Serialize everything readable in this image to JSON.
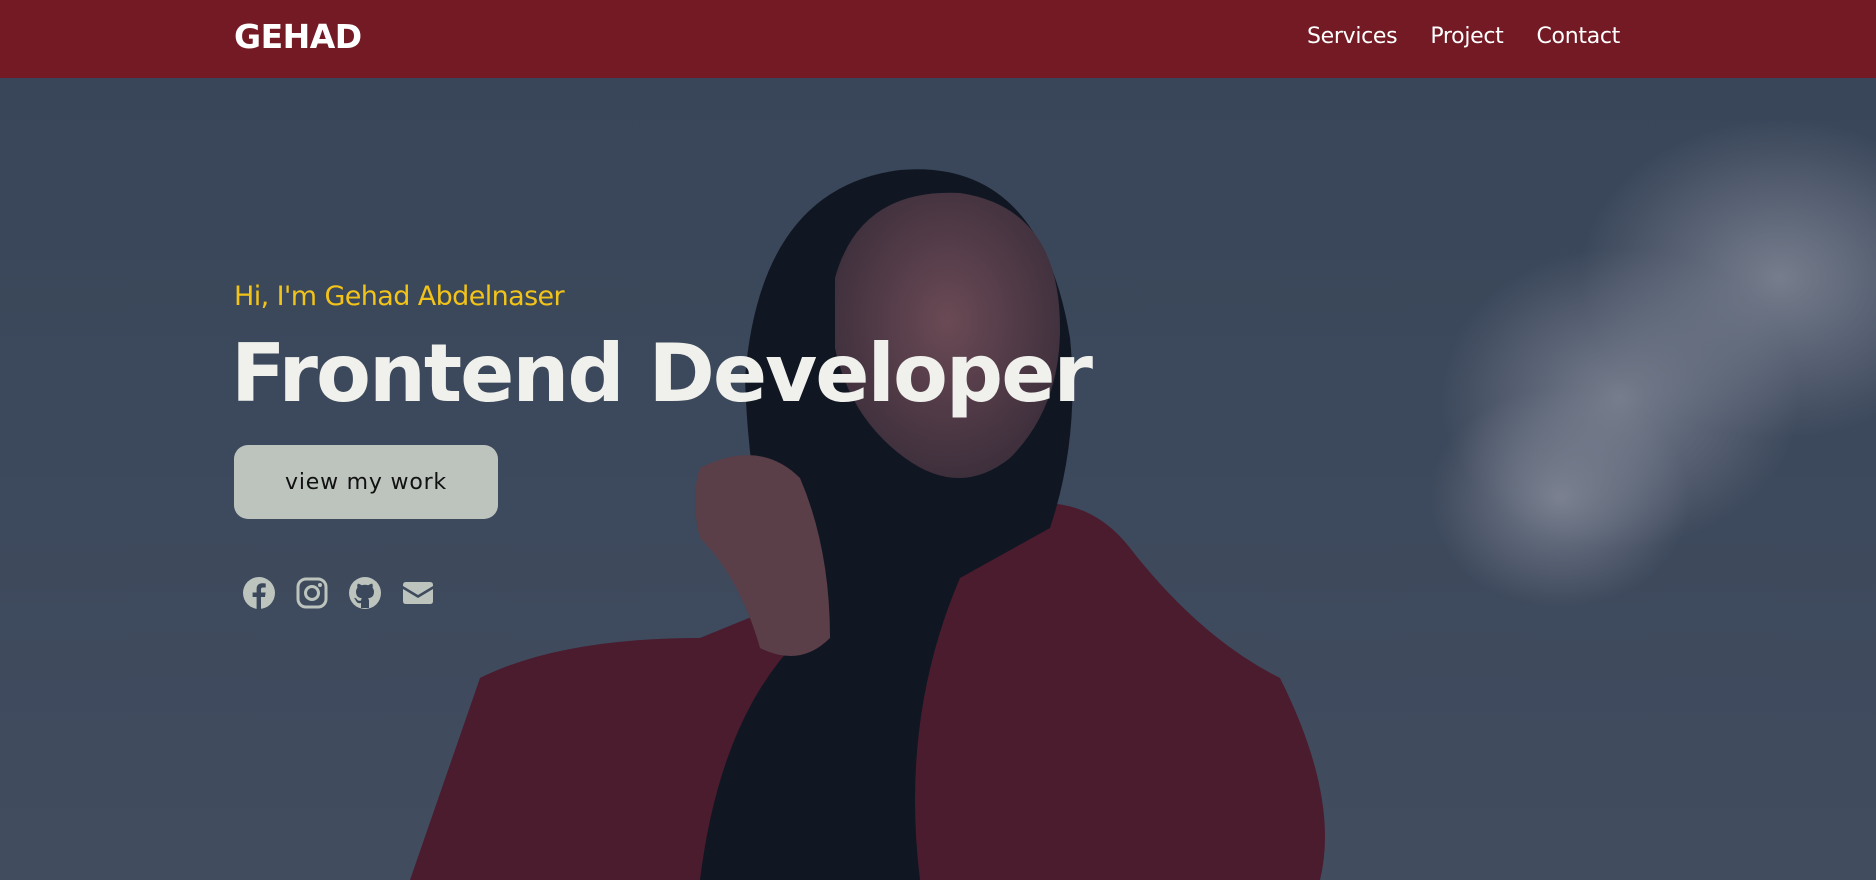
{
  "nav": {
    "brand": "GEHAD",
    "links": [
      "Services",
      "Project",
      "Contact"
    ]
  },
  "hero": {
    "greeting": "Hi, I'm Gehad Abdelnaser",
    "headline": "Frontend Developer",
    "cta_label": "view my work",
    "socials": [
      "facebook-icon",
      "instagram-icon",
      "github-icon",
      "envelope-icon"
    ]
  },
  "colors": {
    "navbar": "#741a24",
    "accent": "#f2c318",
    "headline": "#f0f0ec",
    "button": "#bcc4bd",
    "hero_overlay": "#3b475a"
  }
}
